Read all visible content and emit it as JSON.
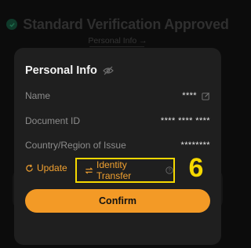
{
  "background": {
    "header_title": "Standard Verification Approved",
    "sub_link": "Personal Info →"
  },
  "modal": {
    "title": "Personal Info",
    "fields": [
      {
        "label": "Name",
        "value": "****"
      },
      {
        "label": "Document ID",
        "value": "**** **** ****"
      },
      {
        "label": "Country/Region of Issue",
        "value": "********"
      }
    ],
    "actions": {
      "update_label": "Update",
      "identity_transfer_label": "Identity Transfer"
    },
    "confirm_label": "Confirm"
  },
  "annotation": {
    "step_number": "6"
  },
  "colors": {
    "accent": "#f39a26",
    "highlight": "#f5d800",
    "modal_bg": "#1f1f1f"
  },
  "icons": [
    "check-circle-icon",
    "eye-slash-icon",
    "edit-icon",
    "refresh-icon",
    "transfer-icon",
    "help-icon"
  ]
}
